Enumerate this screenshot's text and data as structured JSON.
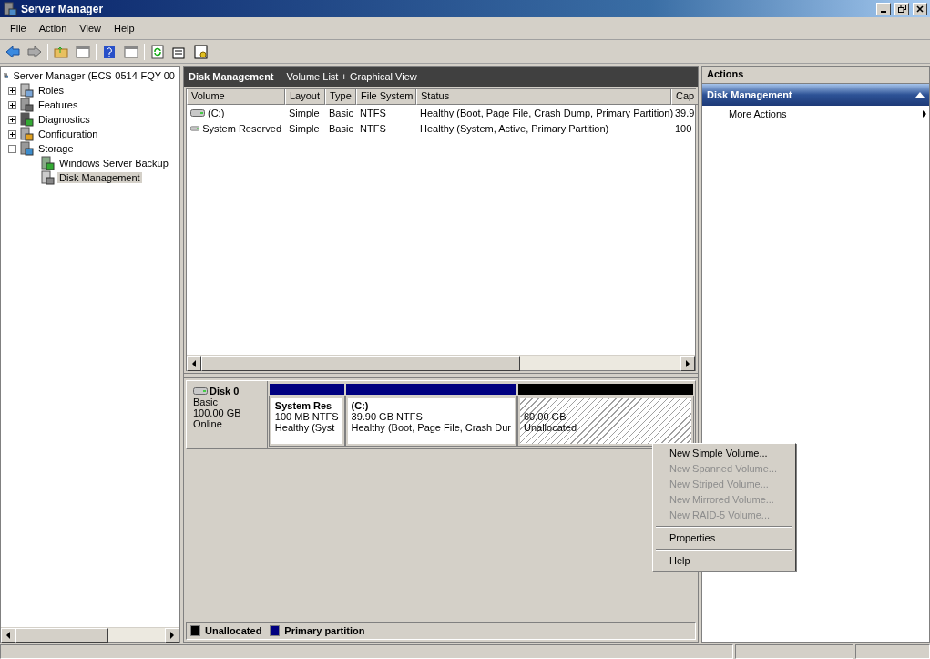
{
  "window": {
    "title": "Server Manager"
  },
  "menu": [
    {
      "label": "File"
    },
    {
      "label": "Action"
    },
    {
      "label": "View"
    },
    {
      "label": "Help"
    }
  ],
  "tree": {
    "label": "Server Manager (ECS-0514-FQY-00",
    "selected": false,
    "children": [
      {
        "label": "Roles",
        "expanded": false,
        "selected": false
      },
      {
        "label": "Features",
        "expanded": false,
        "selected": false
      },
      {
        "label": "Diagnostics",
        "expanded": false,
        "selected": false
      },
      {
        "label": "Configuration",
        "expanded": false,
        "selected": false
      },
      {
        "label": "Storage",
        "expanded": true,
        "selected": false,
        "children": [
          {
            "label": "Windows Server Backup",
            "selected": false
          },
          {
            "label": "Disk Management",
            "selected": true
          }
        ]
      }
    ]
  },
  "center": {
    "title": "Disk Management",
    "subtitle": "Volume List + Graphical View"
  },
  "table": {
    "columns": [
      "Volume",
      "Layout",
      "Type",
      "File System",
      "Status",
      "Cap"
    ],
    "rows": [
      {
        "cells": [
          "(C:)",
          "Simple",
          "Basic",
          "NTFS",
          "Healthy (Boot, Page File, Crash Dump, Primary Partition)",
          "39.9"
        ]
      },
      {
        "cells": [
          "System Reserved",
          "Simple",
          "Basic",
          "NTFS",
          "Healthy (System, Active, Primary Partition)",
          "100"
        ]
      }
    ]
  },
  "disk": {
    "name": "Disk 0",
    "type": "Basic",
    "size": "100.00 GB",
    "state": "Online",
    "partitions": [
      {
        "kind": "primary",
        "color": "#000080",
        "name": "System Res",
        "detail": "100 MB NTFS",
        "status": "Healthy (Syst"
      },
      {
        "kind": "primary",
        "color": "#000080",
        "name": "(C:)",
        "detail": "39.90 GB NTFS",
        "status": "Healthy (Boot, Page File, Crash Dur"
      },
      {
        "kind": "unallocated",
        "color": "#000000",
        "detail": "60.00 GB",
        "status": "Unallocated"
      }
    ]
  },
  "legend": [
    {
      "label": "Unallocated",
      "color": "#000000"
    },
    {
      "label": "Primary partition",
      "color": "#000080"
    }
  ],
  "actions": {
    "title": "Actions",
    "section": "Disk Management",
    "items": [
      {
        "label": "More Actions"
      }
    ]
  },
  "context_menu": [
    {
      "kind": "item",
      "label": "New Simple Volume...",
      "disabled": false
    },
    {
      "kind": "item",
      "label": "New Spanned Volume...",
      "disabled": true
    },
    {
      "kind": "item",
      "label": "New Striped Volume...",
      "disabled": true
    },
    {
      "kind": "item",
      "label": "New Mirrored Volume...",
      "disabled": true
    },
    {
      "kind": "item",
      "label": "New RAID-5 Volume...",
      "disabled": true
    },
    {
      "kind": "separator"
    },
    {
      "kind": "item",
      "label": "Properties",
      "disabled": false
    },
    {
      "kind": "separator"
    },
    {
      "kind": "item",
      "label": "Help",
      "disabled": false
    }
  ]
}
